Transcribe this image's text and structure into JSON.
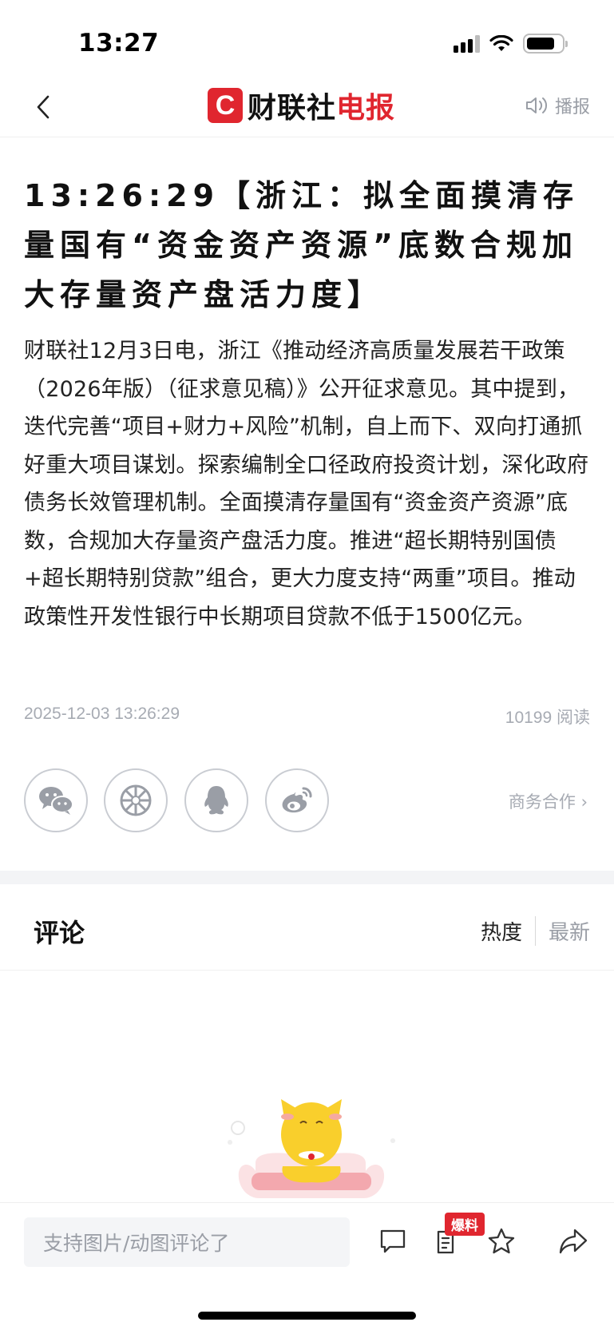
{
  "status_bar": {
    "time": "13:27"
  },
  "nav": {
    "logo_mark": "C",
    "logo_text_black": "财联社",
    "logo_text_red": "电报",
    "broadcast_label": "播报"
  },
  "article": {
    "title": "13:26:29【浙江：拟全面摸清存量国有“资金资产资源”底数合规加大存量资产盘活力度】",
    "body": "财联社12月3日电，浙江《推动经济高质量发展若干政策（2026年版）（征求意见稿）》公开征求意见。其中提到，迭代完善“项目+财力+风险”机制，自上而下、双向打通抓好重大项目谋划。探索编制全口径政府投资计划，深化政府债务长效管理机制。全面摸清存量国有“资金资产资源”底数，合规加大存量资产盘活力度。推进“超长期特别国债+超长期特别贷款”组合，更大力度支持“两重”项目。推动政策性开发性银行中长期项目贷款不低于1500亿元。",
    "datetime": "2025-12-03 13:26:29",
    "reads": "10199 阅读"
  },
  "share": {
    "icons": [
      "wechat-icon",
      "moments-icon",
      "qq-icon",
      "weibo-icon"
    ],
    "business_label": "商务合作 ›"
  },
  "comments": {
    "title": "评论",
    "sort_hot": "热度",
    "sort_new": "最新"
  },
  "bottom_bar": {
    "input_placeholder": "支持图片/动图评论了",
    "tip_badge": "爆料"
  },
  "colors": {
    "brand_red": "#e0262f",
    "muted_gray": "#a7abb3"
  }
}
